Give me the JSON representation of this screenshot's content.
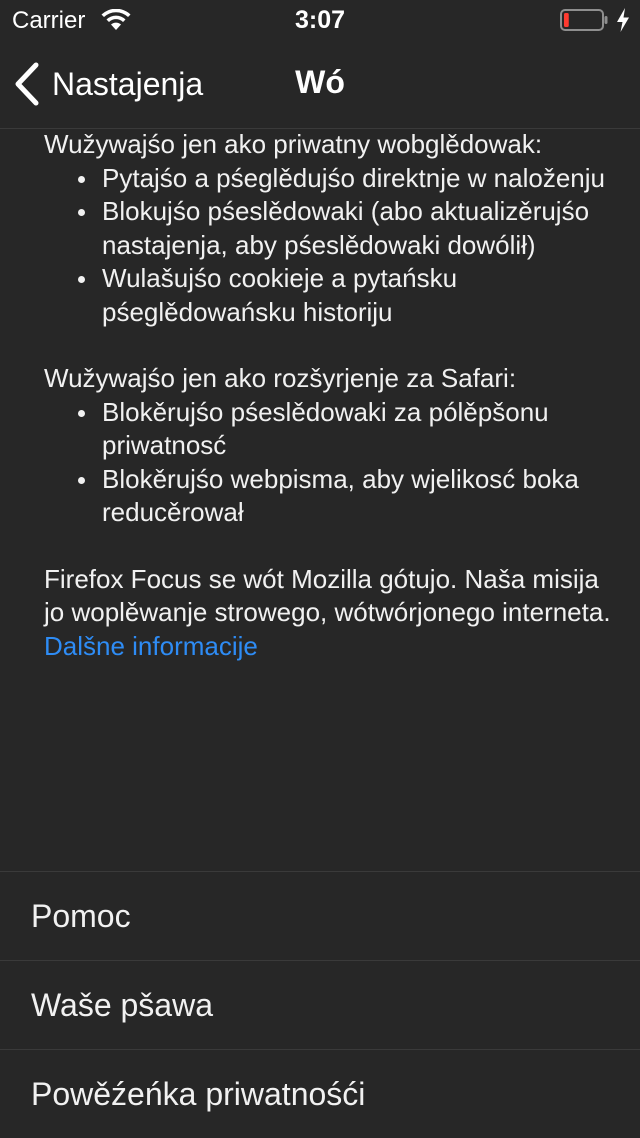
{
  "status_bar": {
    "carrier": "Carrier",
    "time": "3:07",
    "battery_level_percent": 12,
    "battery_color": "#ff3b30",
    "charging": true
  },
  "nav": {
    "back_label": "Nastajenja",
    "title": "Wó"
  },
  "content": {
    "section1_intro": "Wužywajśo jen ako priwatny wobglědowak:",
    "section1_items": [
      "Pytajśo a pśeglědujśo direktnje w naloženju",
      "Blokujśo pśeslědowaki (abo aktualizěrujśo nastajenja, aby pśeslědowaki dowólił)",
      "Wulašujśo cookieje a pytańsku pśeglědowańsku historiju"
    ],
    "section2_intro": "Wužywajśo jen ako rozšyrjenje za Safari:",
    "section2_items": [
      "Blokěrujśo pśeslědowaki za pólěpšonu priwatnosć",
      "Blokěrujśo webpisma, aby wjelikosć boka reducěrował"
    ],
    "about": "Firefox Focus se wót Mozilla gótujo. Naša misija jo woplěwanje strowego, wótwórjonego interneta.",
    "learn_more": "Dalšne informacije",
    "link_color": "#2e8cf5"
  },
  "menu": {
    "items": [
      {
        "label": "Pomoc"
      },
      {
        "label": "Waše pšawa"
      },
      {
        "label": "Powěźeńka priwatnośći"
      }
    ]
  }
}
